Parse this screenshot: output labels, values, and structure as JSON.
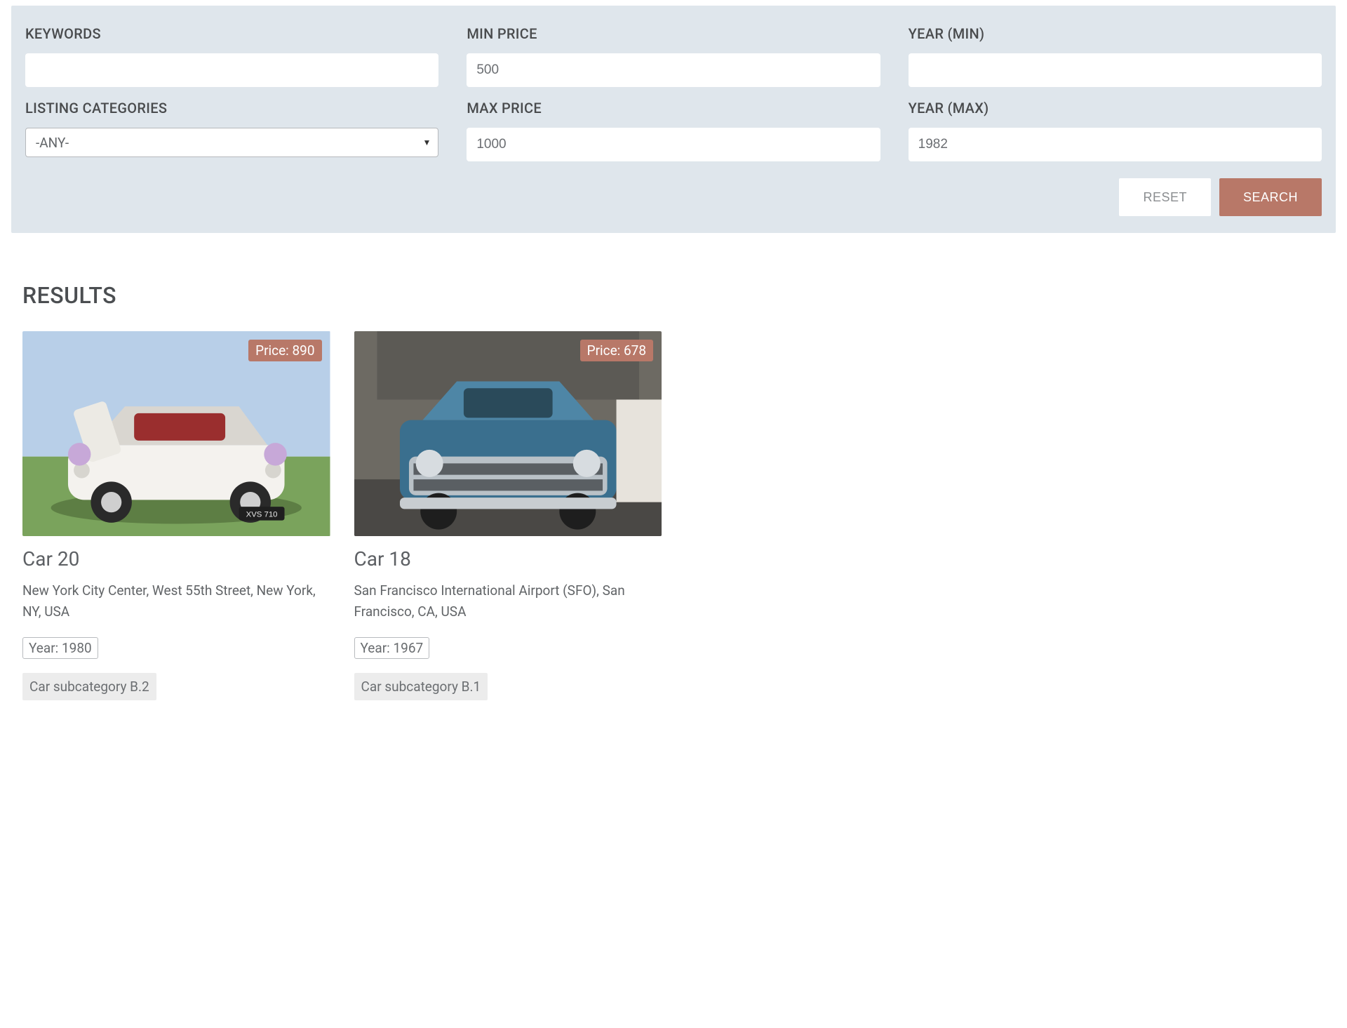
{
  "search": {
    "keywords_label": "KEYWORDS",
    "keywords_value": "",
    "listing_categories_label": "LISTING CATEGORIES",
    "listing_categories_selected": "-ANY-",
    "min_price_label": "MIN PRICE",
    "min_price_value": "500",
    "max_price_label": "MAX PRICE",
    "max_price_value": "1000",
    "year_min_label": "YEAR (MIN)",
    "year_min_value": "",
    "year_max_label": "YEAR (MAX)",
    "year_max_value": "1982",
    "reset_label": "RESET",
    "search_label": "SEARCH"
  },
  "results": {
    "heading": "RESULTS",
    "items": [
      {
        "price_label": "Price: 890",
        "title": "Car 20",
        "location": "New York City Center, West 55th Street, New York, NY, USA",
        "year_label": "Year: 1980",
        "subcategory": "Car subcategory B.2"
      },
      {
        "price_label": "Price: 678",
        "title": "Car 18",
        "location": "San Francisco International Airport (SFO), San Francisco, CA, USA",
        "year_label": "Year: 1967",
        "subcategory": "Car subcategory B.1"
      }
    ]
  }
}
